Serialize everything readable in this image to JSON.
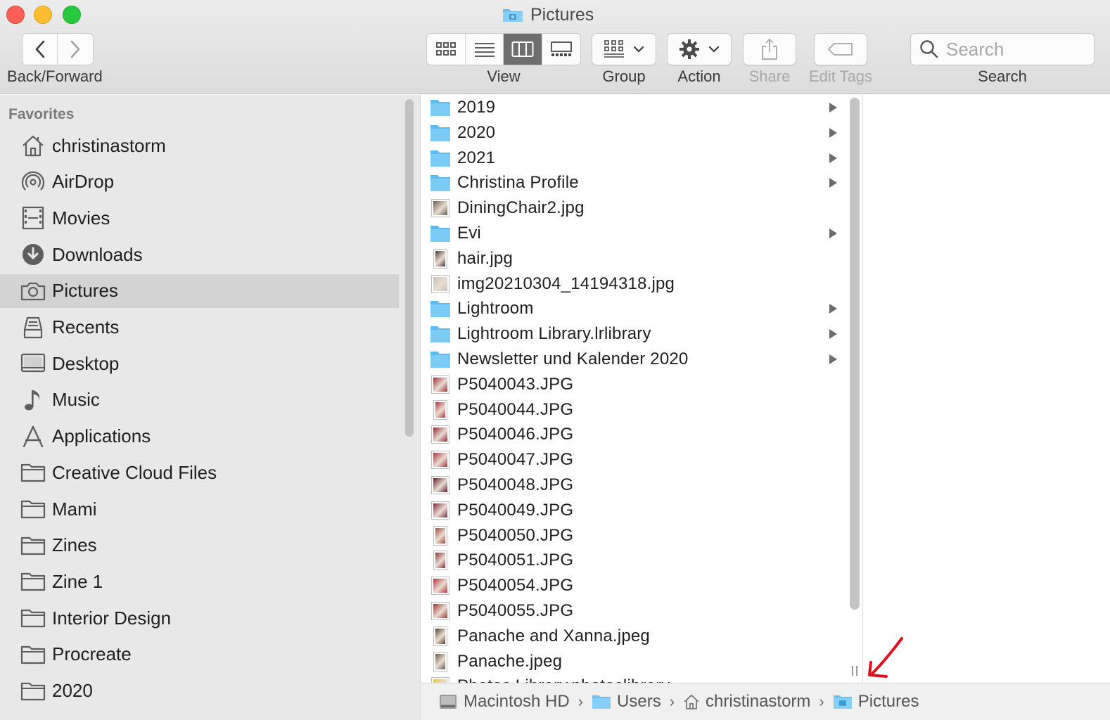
{
  "window": {
    "title": "Pictures"
  },
  "toolbar": {
    "nav_label": "Back/Forward",
    "view_label": "View",
    "group_label": "Group",
    "action_label": "Action",
    "share_label": "Share",
    "edit_tags_label": "Edit Tags",
    "search_label": "Search",
    "search_placeholder": "Search",
    "view_modes": [
      "icon",
      "list",
      "column",
      "gallery"
    ],
    "active_view": "column"
  },
  "sidebar": {
    "header": "Favorites",
    "selected": "Pictures",
    "items": [
      {
        "label": "christinastorm",
        "icon": "home-icon"
      },
      {
        "label": "AirDrop",
        "icon": "airdrop-icon"
      },
      {
        "label": "Movies",
        "icon": "film-icon"
      },
      {
        "label": "Downloads",
        "icon": "download-icon"
      },
      {
        "label": "Pictures",
        "icon": "camera-icon"
      },
      {
        "label": "Recents",
        "icon": "recents-icon"
      },
      {
        "label": "Desktop",
        "icon": "desktop-icon"
      },
      {
        "label": "Music",
        "icon": "music-note-icon"
      },
      {
        "label": "Applications",
        "icon": "applications-icon"
      },
      {
        "label": "Creative Cloud Files",
        "icon": "folder-icon"
      },
      {
        "label": "Mami",
        "icon": "folder-icon"
      },
      {
        "label": "Zines",
        "icon": "folder-icon"
      },
      {
        "label": "Zine 1",
        "icon": "folder-icon"
      },
      {
        "label": "Interior Design",
        "icon": "folder-icon"
      },
      {
        "label": "Procreate",
        "icon": "folder-icon"
      },
      {
        "label": "2020",
        "icon": "folder-icon"
      }
    ]
  },
  "files": [
    {
      "name": "2019",
      "kind": "folder"
    },
    {
      "name": "2020",
      "kind": "folder"
    },
    {
      "name": "2021",
      "kind": "folder"
    },
    {
      "name": "Christina Profile",
      "kind": "folder"
    },
    {
      "name": "DiningChair2.jpg",
      "kind": "image",
      "tint": "#6b5a4a"
    },
    {
      "name": "Evi",
      "kind": "folder"
    },
    {
      "name": "hair.jpg",
      "kind": "image",
      "tint": "#4a3a36",
      "tall": true
    },
    {
      "name": "img20210304_14194318.jpg",
      "kind": "image",
      "tint": "#c9c2b8"
    },
    {
      "name": "Lightroom",
      "kind": "folder"
    },
    {
      "name": "Lightroom Library.lrlibrary",
      "kind": "folder"
    },
    {
      "name": "Newsletter und Kalender 2020",
      "kind": "folder"
    },
    {
      "name": "P5040043.JPG",
      "kind": "image",
      "tint": "#9b2f35"
    },
    {
      "name": "P5040044.JPG",
      "kind": "image",
      "tint": "#b5343f",
      "tall": true
    },
    {
      "name": "P5040046.JPG",
      "kind": "image",
      "tint": "#8e2a33"
    },
    {
      "name": "P5040047.JPG",
      "kind": "image",
      "tint": "#a8353d"
    },
    {
      "name": "P5040048.JPG",
      "kind": "image",
      "tint": "#5a1e2a"
    },
    {
      "name": "P5040049.JPG",
      "kind": "image",
      "tint": "#7d2a3c"
    },
    {
      "name": "P5040050.JPG",
      "kind": "image",
      "tint": "#a24a3a",
      "tall": true
    },
    {
      "name": "P5040051.JPG",
      "kind": "image",
      "tint": "#8a2d33",
      "tall": true
    },
    {
      "name": "P5040054.JPG",
      "kind": "image",
      "tint": "#b5343f"
    },
    {
      "name": "P5040055.JPG",
      "kind": "image",
      "tint": "#9b3a33"
    },
    {
      "name": "Panache and Xanna.jpeg",
      "kind": "image",
      "tint": "#5a4430",
      "tall": true
    },
    {
      "name": "Panache.jpeg",
      "kind": "image",
      "tint": "#6b5a48",
      "tall": true
    },
    {
      "name": "Photos Library.photoslibrary",
      "kind": "image",
      "tint": "#e6c35a"
    }
  ],
  "pathbar": [
    {
      "label": "Macintosh HD",
      "icon": "hard-drive-icon"
    },
    {
      "label": "Users",
      "icon": "folder-icon"
    },
    {
      "label": "christinastorm",
      "icon": "home-icon"
    },
    {
      "label": "Pictures",
      "icon": "pictures-folder-icon"
    }
  ],
  "colors": {
    "folder_blue": "#7ccbf5",
    "selection_gray": "#d3d3d3",
    "annotation_red": "#e0111b"
  }
}
